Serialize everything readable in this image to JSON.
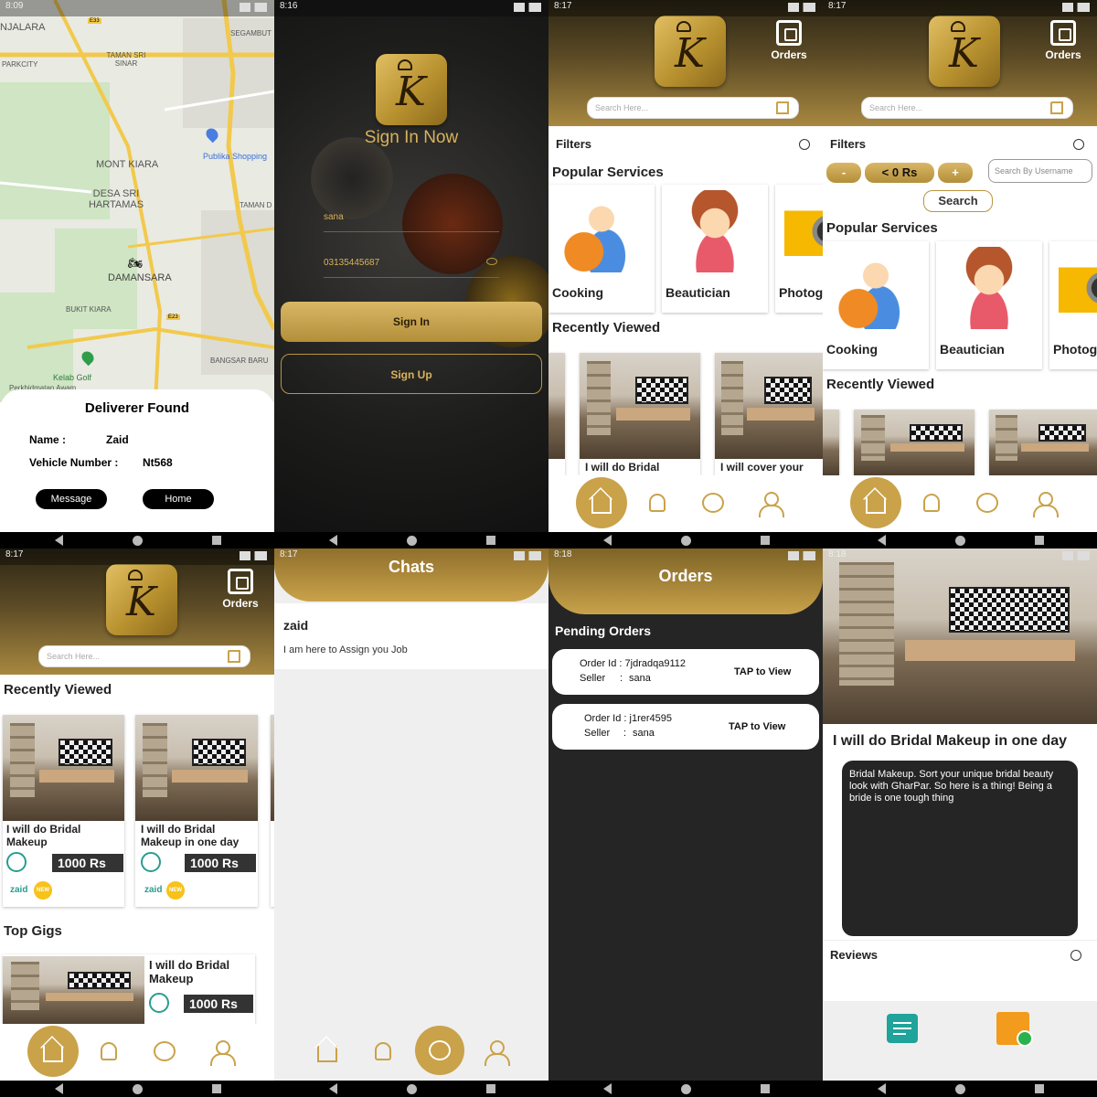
{
  "status_times": {
    "p1": "8:09",
    "p2": "8:16",
    "p3": "8:17",
    "p4": "8:17",
    "p5": "8:17",
    "p6": "8:17",
    "p7": "8:18",
    "p8": "8:18"
  },
  "map": {
    "labels": [
      "NJALARA",
      "SEGAMBUT",
      "TAMAN SRI SINAR",
      "PARKCITY",
      "Publika Shopping",
      "MONT KIARA",
      "DESA SRI HARTAMAS",
      "TAMAN D",
      "DAMANSARA",
      "BUKIT KIARA",
      "BANGSAR BARU",
      "Kelab Golf",
      "Perkhidmatan Awam"
    ],
    "road_labels": [
      "E33",
      "E23"
    ],
    "card": {
      "title": "Deliverer Found",
      "name_label": "Name :",
      "name_value": "Zaid",
      "vehicle_label": "Vehicle Number :",
      "vehicle_value": "Nt568",
      "message_btn": "Message",
      "home_btn": "Home"
    }
  },
  "signin": {
    "title": "Sign In Now",
    "username": "sana",
    "password": "03135445687",
    "signin_btn": "Sign In",
    "signup_btn": "Sign Up"
  },
  "home": {
    "orders_label": "Orders",
    "search_placeholder": "Search Here...",
    "filters_label": "Filters",
    "popular_title": "Popular Services",
    "services": [
      "Cooking",
      "Beautician",
      "Photog"
    ],
    "recent_title": "Recently Viewed",
    "recent_items": [
      "I will do Bridal",
      "I will cover your"
    ]
  },
  "filters_open": {
    "minus": "-",
    "price": "< 0 Rs",
    "plus": "+",
    "username_placeholder": "Search By Username",
    "search_btn": "Search"
  },
  "home2": {
    "recent_items": [
      {
        "title": "I will do Bridal Makeup",
        "price": "1000 Rs",
        "seller": "zaid",
        "badge": "NEW"
      },
      {
        "title": "I will do Bridal Makeup in one day",
        "price": "1000 Rs",
        "seller": "zaid",
        "badge": "NEW"
      }
    ],
    "top_gigs_title": "Top Gigs",
    "top_gig": {
      "title": "I will do Bridal Makeup",
      "price": "1000 Rs"
    }
  },
  "chats": {
    "title": "Chats",
    "items": [
      {
        "name": "zaid",
        "message": "I am here to Assign you Job"
      }
    ]
  },
  "orders": {
    "title": "Orders",
    "pending_title": "Pending Orders",
    "list": [
      {
        "order_label": "Order Id : 7jdradqa9112",
        "seller_label": "Seller",
        "seller_sep": ":",
        "seller": "sana",
        "action": "TAP to View"
      },
      {
        "order_label": "Order Id : j1rer4595",
        "seller_label": "Seller",
        "seller_sep": ":",
        "seller": "sana",
        "action": "TAP to View"
      }
    ]
  },
  "gig": {
    "title": "I will do Bridal Makeup in one day",
    "description": "Bridal Makeup. Sort your unique bridal beauty look with GharPar. So here is a thing! Being a bride is one tough thing",
    "reviews_label": "Reviews"
  },
  "colors": {
    "gold": "#c9a24a",
    "dark": "#252525",
    "brown": "#5b4a25"
  }
}
